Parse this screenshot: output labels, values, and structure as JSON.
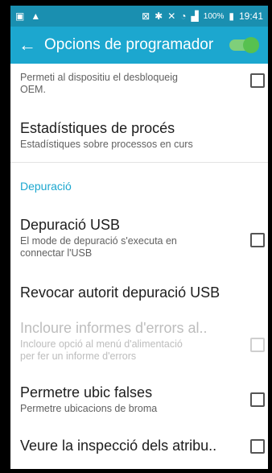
{
  "statusbar": {
    "battery": "100%",
    "time": "19:41"
  },
  "appbar": {
    "back_glyph": "←",
    "title": "Opcions de programador",
    "master_toggle_on": true
  },
  "items": [
    {
      "title": "",
      "subtitle": "Permeti al dispositiu el desbloqueig OEM.",
      "checked": false,
      "enabled": true
    },
    {
      "title": "Estadístiques de procés",
      "subtitle": "Estadístiques sobre processos en curs"
    },
    {
      "title": "Depuració USB",
      "subtitle": "El mode de depuració s'executa en connectar l'USB",
      "checked": false,
      "enabled": true
    },
    {
      "title": "Revocar autorit depuració USB"
    },
    {
      "title": "Incloure informes d'errors al..",
      "subtitle": "Incloure opció al menú d'alimentació per fer un informe d'errors",
      "checked": false,
      "enabled": false
    },
    {
      "title": "Permetre ubic falses",
      "subtitle": "Permetre ubicacions de broma",
      "checked": false,
      "enabled": true
    },
    {
      "title": "Veure la inspecció dels atribu..",
      "checked": false,
      "enabled": true
    }
  ],
  "section": {
    "label": "Depuració"
  },
  "icons": [
    "image-icon",
    "alert-icon",
    "nfc-icon",
    "bluetooth-icon",
    "mute-icon",
    "wifi-icon",
    "signal-icon",
    "battery-icon"
  ]
}
